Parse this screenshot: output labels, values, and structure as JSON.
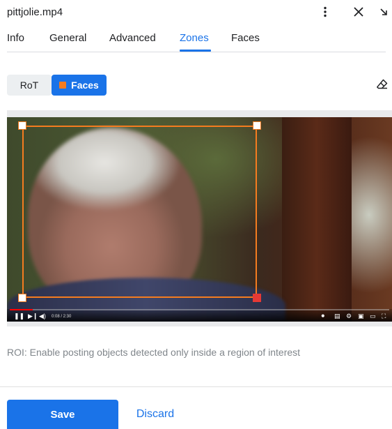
{
  "window": {
    "title": "pittjolie.mp4"
  },
  "header_icons": [
    "more-vert-icon",
    "close-icon",
    "collapse-arrow-icon"
  ],
  "tabs": [
    {
      "label": "Info",
      "active": false
    },
    {
      "label": "General",
      "active": false
    },
    {
      "label": "Advanced",
      "active": false
    },
    {
      "label": "Zones",
      "active": true
    },
    {
      "label": "Faces",
      "active": false
    }
  ],
  "zone_modes": {
    "rot_label": "RoT",
    "faces_label": "Faces",
    "selected": "Faces"
  },
  "colors": {
    "accent": "#1a73e8",
    "zone": "#f57c1f",
    "handle_active": "#e53935"
  },
  "video": {
    "time_label": "0:08 / 2:30",
    "progress": 0.06,
    "controls": [
      "pause-icon",
      "next-icon",
      "volume-icon",
      "autoplay-toggle",
      "subtitles-icon",
      "settings-icon",
      "miniplayer-icon",
      "theater-icon",
      "fullscreen-icon"
    ]
  },
  "roi_description": "ROI: Enable posting objects detected only inside a region of interest",
  "actions": {
    "save_label": "Save",
    "discard_label": "Discard"
  }
}
